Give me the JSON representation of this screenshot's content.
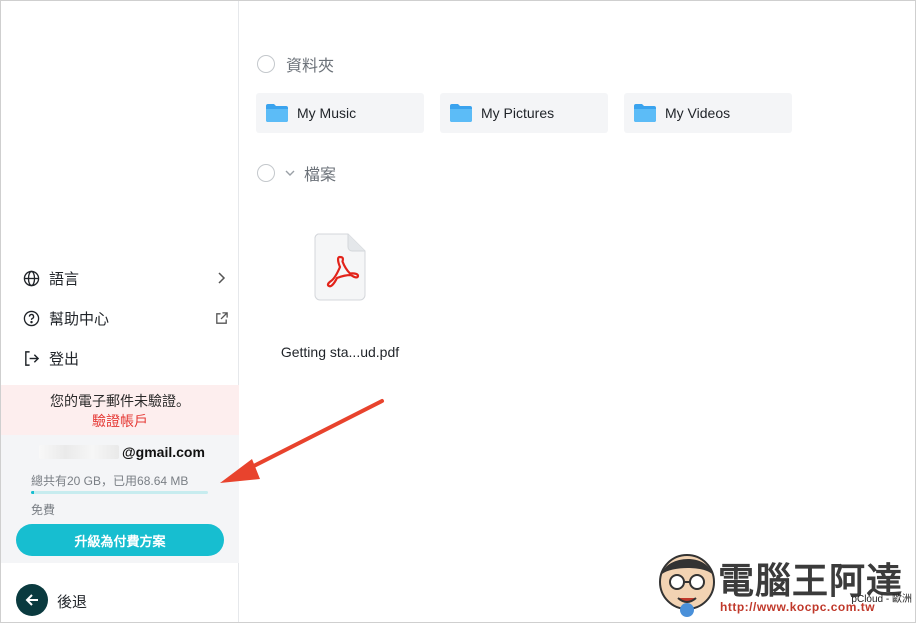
{
  "sidebar": {
    "menu": [
      {
        "label": "語言",
        "icon": "globe-icon",
        "trail_icon": "chevron-right-icon"
      },
      {
        "label": "幫助中心",
        "icon": "help-circle-icon",
        "trail_icon": "external-link-icon"
      },
      {
        "label": "登出",
        "icon": "logout-icon",
        "trail_icon": ""
      }
    ],
    "verify": {
      "message": "您的電子郵件未驗證。",
      "link": "驗證帳戶"
    },
    "account": {
      "email": "@gmail.com",
      "storage_text": "總共有20 GB，已用68.64 MB",
      "storage_used_fraction": 0.0034,
      "plan": "免費",
      "upgrade_label": "升級為付費方案"
    },
    "back_label": "後退"
  },
  "main": {
    "folders_section_title": "資料夾",
    "folders": [
      {
        "name": "My Music"
      },
      {
        "name": "My Pictures"
      },
      {
        "name": "My Videos"
      }
    ],
    "files_section_title": "檔案",
    "files": [
      {
        "name": "Getting sta...ud.pdf",
        "icon": "pdf-file-icon"
      }
    ]
  },
  "watermark": {
    "title": "電腦王阿達",
    "url": "http://www.kocpc.com.tw",
    "caption": "pCloud - 歐洲"
  },
  "colors": {
    "accent": "#17bed0",
    "danger": "#e53935",
    "folder_blue": "#4fb3f6",
    "pdf_red": "#e2231a",
    "annotation_arrow": "#e8432d"
  }
}
